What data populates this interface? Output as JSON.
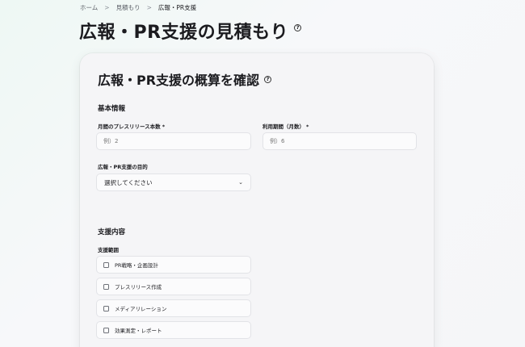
{
  "breadcrumb": {
    "items": [
      "ホーム",
      "見積もり",
      "広報・PR支援"
    ],
    "separator": ">"
  },
  "page": {
    "title": "広報・PR支援の見積もり",
    "help": "?"
  },
  "card": {
    "title": "広報・PR支援の概算を確認",
    "help": "?",
    "basic_info": {
      "heading": "基本情報",
      "press_release_count": {
        "label": "月間のプレスリリース本数",
        "required": "*",
        "placeholder": "例）2"
      },
      "usage_period": {
        "label": "利用期間（月数）",
        "required": "*",
        "placeholder": "例）6"
      },
      "purpose": {
        "label": "広報・PR支援の目的",
        "selected": "選択してください"
      }
    },
    "support": {
      "heading": "支援内容",
      "scope_label": "支援範囲",
      "options": [
        "PR戦略・企画設計",
        "プレスリリース作成",
        "メディアリレーション",
        "効果測定・レポート"
      ]
    }
  }
}
